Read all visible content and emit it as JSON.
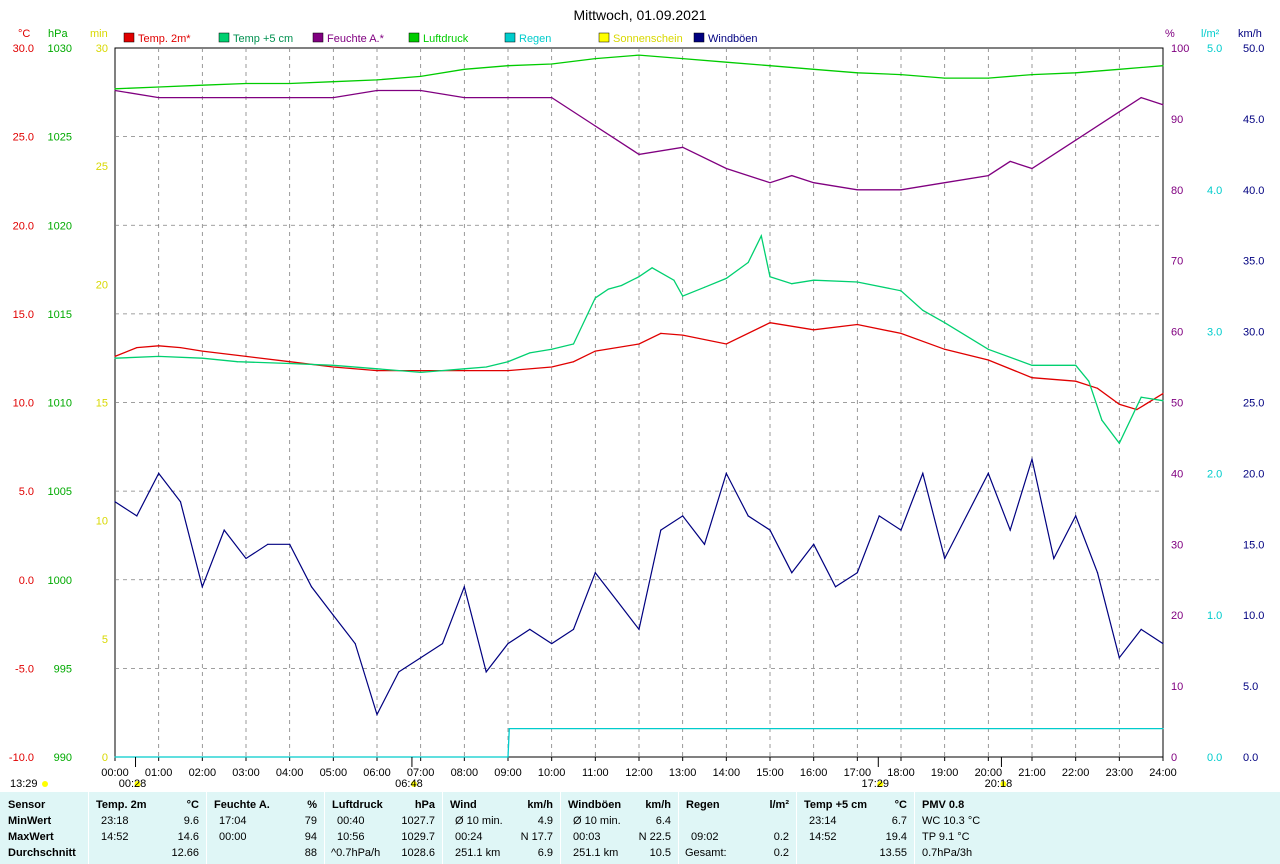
{
  "title": "Mittwoch, 01.09.2021",
  "colors": {
    "temp2m": "#e00000",
    "temp5cm": "#00d070",
    "humidity": "#800080",
    "pressure": "#00cc00",
    "rain": "#00cccc",
    "sunshine": "#ffff00",
    "gusts": "#000080",
    "grid": "#808080",
    "footer_bg": "#dff6f6"
  },
  "legend": [
    {
      "label": "Temp. 2m*",
      "color": "#e00000"
    },
    {
      "label": "Temp +5 cm",
      "color": "#00d070"
    },
    {
      "label": "Feuchte A.*",
      "color": "#800080"
    },
    {
      "label": "Luftdruck",
      "color": "#00cc00"
    },
    {
      "label": "Regen",
      "color": "#00cccc"
    },
    {
      "label": "Sonnenschein",
      "color": "#ffff00"
    },
    {
      "label": "Windböen",
      "color": "#000080"
    }
  ],
  "axes": {
    "left_units": {
      "temp": "°C",
      "pressure": "hPa",
      "sun": "min"
    },
    "right_units": {
      "humidity": "%",
      "rain": "l/m²",
      "wind": "km/h"
    },
    "temp_ticks": [
      "30.0",
      "25.0",
      "20.0",
      "15.0",
      "10.0",
      "5.0",
      "0.0",
      "-5.0",
      "-10.0"
    ],
    "pressure_ticks": [
      "1030",
      "1025",
      "1020",
      "1015",
      "1010",
      "1005",
      "1000",
      "995",
      "990"
    ],
    "sun_ticks": [
      "30",
      "25",
      "20",
      "15",
      "10",
      "5",
      "0"
    ],
    "humidity_ticks": [
      "100",
      "90",
      "80",
      "70",
      "60",
      "50",
      "40",
      "30",
      "20",
      "10",
      "0"
    ],
    "rain_ticks": [
      "5.0",
      "4.0",
      "3.0",
      "2.0",
      "1.0",
      "0.0"
    ],
    "wind_ticks": [
      "50.0",
      "45.0",
      "40.0",
      "35.0",
      "30.0",
      "25.0",
      "20.0",
      "15.0",
      "10.0",
      "5.0",
      "0.0"
    ],
    "x_ticks": [
      "00:00",
      "01:00",
      "02:00",
      "03:00",
      "04:00",
      "05:00",
      "06:00",
      "07:00",
      "08:00",
      "09:00",
      "10:00",
      "11:00",
      "12:00",
      "13:00",
      "14:00",
      "15:00",
      "16:00",
      "17:00",
      "18:00",
      "19:00",
      "20:00",
      "21:00",
      "22:00",
      "23:00",
      "24:00"
    ],
    "time_markers": [
      {
        "label": "00:28",
        "hour": 0.47
      },
      {
        "label": "06:48",
        "hour": 6.8
      },
      {
        "label": "17:29",
        "hour": 17.48
      },
      {
        "label": "20:18",
        "hour": 20.3
      }
    ],
    "bottom_left_label": "13:29"
  },
  "chart_data": {
    "type": "line",
    "title": "Mittwoch, 01.09.2021",
    "x_unit": "hour",
    "xlim": [
      0,
      24
    ],
    "ylim_temp": [
      -10,
      30
    ],
    "ylim_pressure": [
      990,
      1030
    ],
    "ylim_humidity": [
      0,
      100
    ],
    "ylim_rain": [
      0,
      5
    ],
    "ylim_wind": [
      0,
      50
    ],
    "grid": true,
    "legend_position": "top",
    "series": [
      {
        "name": "Temp. 2m*",
        "axis": "temp",
        "x": [
          0,
          0.5,
          1,
          1.5,
          2,
          3,
          4,
          5,
          6,
          7,
          8,
          9,
          10,
          10.5,
          11,
          12,
          12.5,
          13,
          14,
          15,
          16,
          17,
          18,
          19,
          20,
          21,
          22,
          22.5,
          23,
          23.4,
          24
        ],
        "y": [
          12.6,
          13.1,
          13.2,
          13.1,
          12.9,
          12.6,
          12.3,
          12.0,
          11.8,
          11.8,
          11.8,
          11.8,
          12.0,
          12.3,
          12.9,
          13.3,
          13.9,
          13.8,
          13.3,
          14.5,
          14.1,
          14.4,
          13.9,
          13.0,
          12.4,
          11.4,
          11.2,
          10.8,
          9.9,
          9.6,
          10.5
        ]
      },
      {
        "name": "Temp +5 cm",
        "axis": "temp",
        "x": [
          0,
          1,
          2,
          2.8,
          4,
          5,
          6,
          7,
          8,
          8.5,
          9,
          9.5,
          10,
          10.5,
          11,
          11.3,
          11.6,
          12,
          12.3,
          12.8,
          13,
          13.5,
          14,
          14.5,
          14.8,
          15,
          15.5,
          16,
          17,
          18,
          18.5,
          19,
          20,
          21,
          22,
          22.3,
          22.6,
          23,
          23.5,
          24
        ],
        "y": [
          12.5,
          12.6,
          12.5,
          12.3,
          12.2,
          12.1,
          11.9,
          11.7,
          11.9,
          12.0,
          12.3,
          12.8,
          13.0,
          13.3,
          15.9,
          16.4,
          16.6,
          17.1,
          17.6,
          16.9,
          16.0,
          16.5,
          17.0,
          17.9,
          19.4,
          17.1,
          16.7,
          16.9,
          16.8,
          16.3,
          15.2,
          14.5,
          13.0,
          12.1,
          12.1,
          11.2,
          9.0,
          7.7,
          10.3,
          10.1
        ]
      },
      {
        "name": "Feuchte A.*",
        "axis": "humidity",
        "x": [
          0,
          1,
          2,
          3,
          4,
          5,
          6,
          7,
          8,
          9,
          10,
          11,
          11.5,
          12,
          13,
          14,
          15,
          15.5,
          16,
          17,
          18,
          19,
          20,
          20.5,
          21,
          22,
          23,
          23.5,
          24
        ],
        "y": [
          94,
          93,
          93,
          93,
          93,
          93,
          94,
          94,
          93,
          93,
          93,
          89,
          87,
          85,
          86,
          83,
          81,
          82,
          81,
          80,
          80,
          81,
          82,
          84,
          83,
          87,
          91,
          93,
          92
        ]
      },
      {
        "name": "Luftdruck",
        "axis": "pressure",
        "x": [
          0,
          1,
          2,
          3,
          4,
          5,
          6,
          7,
          8,
          9,
          10,
          11,
          12,
          13,
          14,
          15,
          16,
          17,
          18,
          19,
          20,
          21,
          22,
          23,
          24
        ],
        "y": [
          1027.7,
          1027.8,
          1027.9,
          1028.0,
          1028.0,
          1028.1,
          1028.2,
          1028.4,
          1028.8,
          1029.0,
          1029.1,
          1029.4,
          1029.6,
          1029.4,
          1029.2,
          1029.0,
          1028.8,
          1028.6,
          1028.5,
          1028.3,
          1028.3,
          1028.5,
          1028.6,
          1028.8,
          1029.0
        ]
      },
      {
        "name": "Regen",
        "axis": "rain",
        "x": [
          0,
          9.0,
          9.03,
          24
        ],
        "y": [
          0,
          0,
          0.2,
          0.2
        ]
      },
      {
        "name": "Windböen",
        "axis": "wind",
        "x": [
          0,
          0.5,
          1,
          1.5,
          2,
          2.5,
          3,
          3.5,
          4,
          4.5,
          5,
          5.5,
          6,
          6.5,
          7,
          7.5,
          8,
          8.5,
          9,
          9.5,
          10,
          10.5,
          11,
          11.5,
          12,
          12.5,
          13,
          13.5,
          14,
          14.5,
          15,
          15.5,
          16,
          16.5,
          17,
          17.5,
          18,
          18.5,
          19,
          19.5,
          20,
          20.5,
          21,
          21.5,
          22,
          22.5,
          23,
          23.5,
          24
        ],
        "y": [
          18,
          17,
          20,
          18,
          12,
          16,
          14,
          15,
          15,
          12,
          10,
          8,
          3,
          6,
          7,
          8,
          12,
          6,
          8,
          9,
          8,
          9,
          13,
          11,
          9,
          16,
          17,
          15,
          20,
          17,
          16,
          13,
          15,
          12,
          13,
          17,
          16,
          20,
          14,
          17,
          20,
          16,
          21,
          14,
          17,
          13,
          7,
          9,
          8
        ]
      }
    ]
  },
  "footer": {
    "sensor": {
      "header": "Sensor",
      "min": "MinWert",
      "max": "MaxWert",
      "avg": "Durchschnitt"
    },
    "temp2m": {
      "header": "Temp. 2m",
      "unit": "°C",
      "min_time": "23:18",
      "min_val": "9.6",
      "max_time": "14:52",
      "max_val": "14.6",
      "avg_val": "12.66"
    },
    "humidity": {
      "header": "Feuchte A.",
      "unit": "%",
      "min_time": "17:04",
      "min_val": "79",
      "max_time": "00:00",
      "max_val": "94",
      "avg_val": "88"
    },
    "pressure": {
      "header": "Luftdruck",
      "unit": "hPa",
      "min_time": "00:40",
      "min_val": "1027.7",
      "max_time": "10:56",
      "max_val": "1029.7",
      "avg_label": "^0.7hPa/h",
      "avg_val": "1028.6"
    },
    "wind": {
      "header": "Wind",
      "unit": "km/h",
      "min_label": "Ø 10 min.",
      "min_val": "4.9",
      "max_time": "00:24",
      "max_dir": "N 17.7",
      "avg_label": "251.1 km",
      "avg_val": "6.9"
    },
    "gusts": {
      "header": "Windböen",
      "unit": "km/h",
      "min_label": "Ø 10 min.",
      "min_val": "6.4",
      "max_time": "00:03",
      "max_dir": "N 22.5",
      "avg_label": "251.1 km",
      "avg_val": "10.5"
    },
    "rain": {
      "header": "Regen",
      "unit": "l/m²",
      "max_time": "09:02",
      "max_val": "0.2",
      "avg_label": "Gesamt:",
      "avg_val": "0.2"
    },
    "temp5cm": {
      "header": "Temp +5 cm",
      "unit": "°C",
      "min_time": "23:14",
      "min_val": "6.7",
      "max_time": "14:52",
      "max_val": "19.4",
      "avg_val": "13.55"
    },
    "pmv": {
      "header": "PMV 0.8",
      "line1": "WC 10.3 °C",
      "line2": "TP 9.1 °C",
      "line3": "0.7hPa/3h"
    }
  }
}
